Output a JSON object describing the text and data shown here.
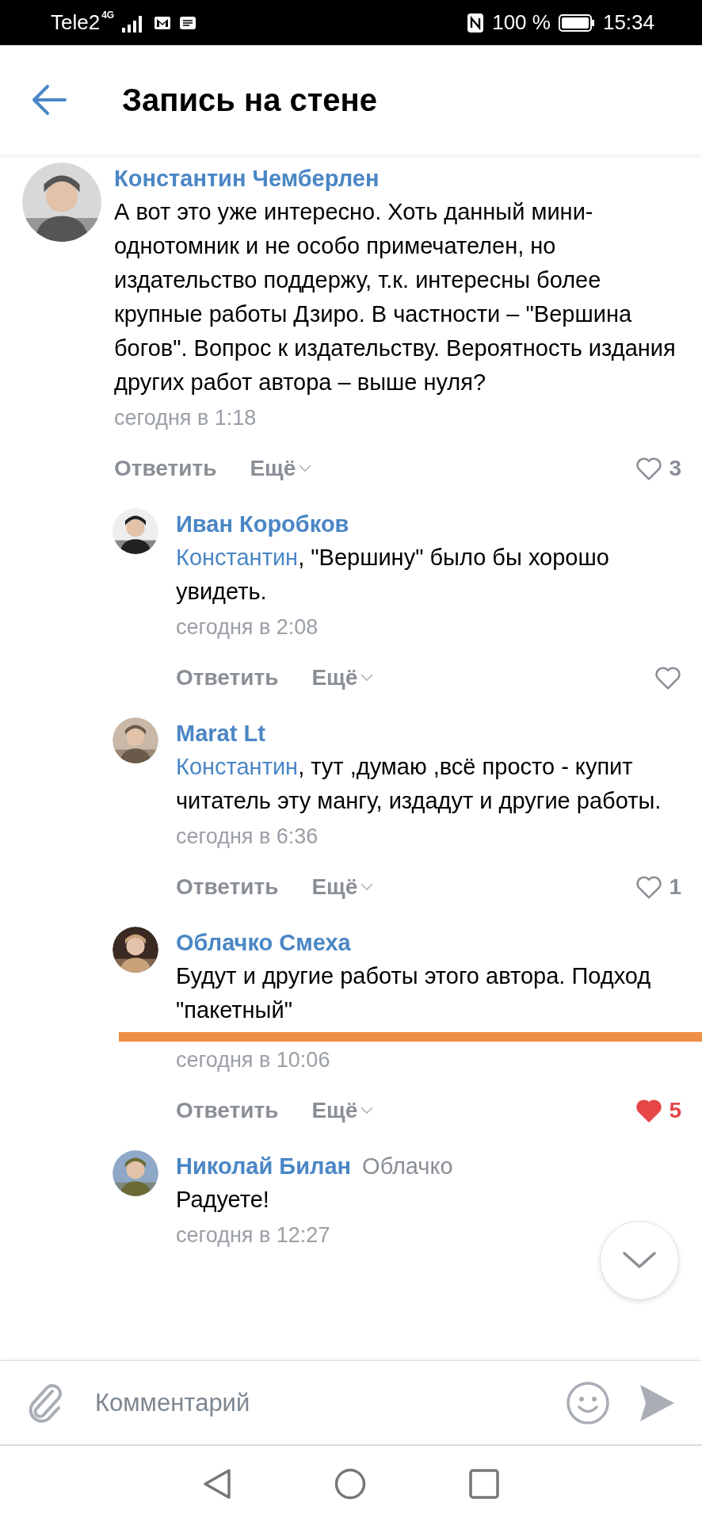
{
  "status_bar": {
    "carrier": "Tele2",
    "network": "4G",
    "battery": "100 %",
    "time": "15:34"
  },
  "header": {
    "title": "Запись на стене"
  },
  "comments": [
    {
      "author": "Константин Чемберлен",
      "text": "А вот это уже интересно. Хоть данный мини-однотомник и не особо примечателен, но издательство поддержу, т.к. интересны более крупные работы Дзиро. В частности – \"Вершина богов\". Вопрос к издательству. Вероятность издания других работ автора – выше нуля?",
      "time": "сегодня в 1:18",
      "reply": "Ответить",
      "more": "Ещё",
      "liked": false,
      "likes": "3",
      "children": [
        {
          "author": "Иван Коробков",
          "mention": "Константин",
          "text": ", \"Вершину\" было бы хорошо увидеть.",
          "time": "сегодня в 2:08",
          "reply": "Ответить",
          "more": "Ещё",
          "liked": false
        },
        {
          "author": "Marat Lt",
          "mention": "Константин",
          "text": ", тут ,думаю ,всё просто - купит читатель эту мангу, издадут и другие работы.",
          "time": "сегодня в 6:36",
          "reply": "Ответить",
          "more": "Ещё",
          "liked": false,
          "likes": "1"
        },
        {
          "author": "Облачко Смеха",
          "text": "Будут и другие работы этого автора. Подход \"пакетный\"",
          "time": "сегодня в 10:06",
          "reply": "Ответить",
          "more": "Ещё",
          "liked": true,
          "likes": "5",
          "marked": true
        },
        {
          "author": "Николай Билан",
          "reply_to": "Облачко",
          "text": "Радуете!",
          "time": "сегодня в 12:27"
        }
      ]
    }
  ],
  "composer": {
    "placeholder": "Комментарий"
  }
}
